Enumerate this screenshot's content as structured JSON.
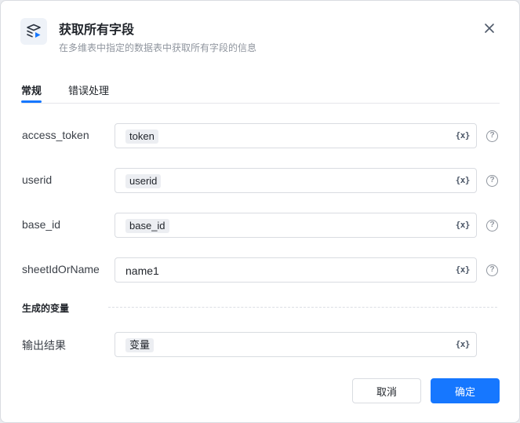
{
  "dialog": {
    "title": "获取所有字段",
    "subtitle": "在多维表中指定的数据表中获取所有字段的信息",
    "header_icon": "stack-play-icon",
    "close_icon": "close-icon"
  },
  "tabs": [
    {
      "label": "常规",
      "active": true
    },
    {
      "label": "错误处理",
      "active": false
    }
  ],
  "params": [
    {
      "label": "access_token",
      "value": "token",
      "chip": true
    },
    {
      "label": "userid",
      "value": "userid",
      "chip": true
    },
    {
      "label": "base_id",
      "value": "base_id",
      "chip": true
    },
    {
      "label": "sheetIdOrName",
      "value": "name1",
      "chip": false
    }
  ],
  "var_icon_text": "{x}",
  "help_icon_text": "?",
  "output_section": {
    "title": "生成的变量",
    "label": "输出结果",
    "value": "变量"
  },
  "buttons": {
    "cancel": "取消",
    "ok": "确定"
  },
  "colors": {
    "accent": "#1677ff",
    "border": "#d9dce1",
    "chip_bg": "#eceef2"
  }
}
